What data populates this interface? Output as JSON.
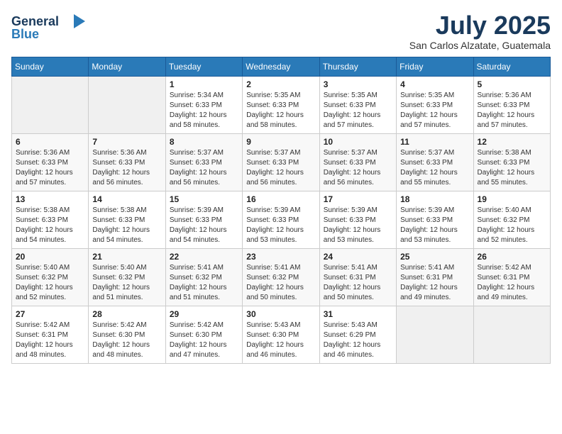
{
  "logo": {
    "general": "General",
    "blue": "Blue"
  },
  "title": {
    "month_year": "July 2025",
    "location": "San Carlos Alzatate, Guatemala"
  },
  "weekdays": [
    "Sunday",
    "Monday",
    "Tuesday",
    "Wednesday",
    "Thursday",
    "Friday",
    "Saturday"
  ],
  "weeks": [
    [
      {
        "day": "",
        "info": ""
      },
      {
        "day": "",
        "info": ""
      },
      {
        "day": "1",
        "info": "Sunrise: 5:34 AM\nSunset: 6:33 PM\nDaylight: 12 hours and 58 minutes."
      },
      {
        "day": "2",
        "info": "Sunrise: 5:35 AM\nSunset: 6:33 PM\nDaylight: 12 hours and 58 minutes."
      },
      {
        "day": "3",
        "info": "Sunrise: 5:35 AM\nSunset: 6:33 PM\nDaylight: 12 hours and 57 minutes."
      },
      {
        "day": "4",
        "info": "Sunrise: 5:35 AM\nSunset: 6:33 PM\nDaylight: 12 hours and 57 minutes."
      },
      {
        "day": "5",
        "info": "Sunrise: 5:36 AM\nSunset: 6:33 PM\nDaylight: 12 hours and 57 minutes."
      }
    ],
    [
      {
        "day": "6",
        "info": "Sunrise: 5:36 AM\nSunset: 6:33 PM\nDaylight: 12 hours and 57 minutes."
      },
      {
        "day": "7",
        "info": "Sunrise: 5:36 AM\nSunset: 6:33 PM\nDaylight: 12 hours and 56 minutes."
      },
      {
        "day": "8",
        "info": "Sunrise: 5:37 AM\nSunset: 6:33 PM\nDaylight: 12 hours and 56 minutes."
      },
      {
        "day": "9",
        "info": "Sunrise: 5:37 AM\nSunset: 6:33 PM\nDaylight: 12 hours and 56 minutes."
      },
      {
        "day": "10",
        "info": "Sunrise: 5:37 AM\nSunset: 6:33 PM\nDaylight: 12 hours and 56 minutes."
      },
      {
        "day": "11",
        "info": "Sunrise: 5:37 AM\nSunset: 6:33 PM\nDaylight: 12 hours and 55 minutes."
      },
      {
        "day": "12",
        "info": "Sunrise: 5:38 AM\nSunset: 6:33 PM\nDaylight: 12 hours and 55 minutes."
      }
    ],
    [
      {
        "day": "13",
        "info": "Sunrise: 5:38 AM\nSunset: 6:33 PM\nDaylight: 12 hours and 54 minutes."
      },
      {
        "day": "14",
        "info": "Sunrise: 5:38 AM\nSunset: 6:33 PM\nDaylight: 12 hours and 54 minutes."
      },
      {
        "day": "15",
        "info": "Sunrise: 5:39 AM\nSunset: 6:33 PM\nDaylight: 12 hours and 54 minutes."
      },
      {
        "day": "16",
        "info": "Sunrise: 5:39 AM\nSunset: 6:33 PM\nDaylight: 12 hours and 53 minutes."
      },
      {
        "day": "17",
        "info": "Sunrise: 5:39 AM\nSunset: 6:33 PM\nDaylight: 12 hours and 53 minutes."
      },
      {
        "day": "18",
        "info": "Sunrise: 5:39 AM\nSunset: 6:33 PM\nDaylight: 12 hours and 53 minutes."
      },
      {
        "day": "19",
        "info": "Sunrise: 5:40 AM\nSunset: 6:32 PM\nDaylight: 12 hours and 52 minutes."
      }
    ],
    [
      {
        "day": "20",
        "info": "Sunrise: 5:40 AM\nSunset: 6:32 PM\nDaylight: 12 hours and 52 minutes."
      },
      {
        "day": "21",
        "info": "Sunrise: 5:40 AM\nSunset: 6:32 PM\nDaylight: 12 hours and 51 minutes."
      },
      {
        "day": "22",
        "info": "Sunrise: 5:41 AM\nSunset: 6:32 PM\nDaylight: 12 hours and 51 minutes."
      },
      {
        "day": "23",
        "info": "Sunrise: 5:41 AM\nSunset: 6:32 PM\nDaylight: 12 hours and 50 minutes."
      },
      {
        "day": "24",
        "info": "Sunrise: 5:41 AM\nSunset: 6:31 PM\nDaylight: 12 hours and 50 minutes."
      },
      {
        "day": "25",
        "info": "Sunrise: 5:41 AM\nSunset: 6:31 PM\nDaylight: 12 hours and 49 minutes."
      },
      {
        "day": "26",
        "info": "Sunrise: 5:42 AM\nSunset: 6:31 PM\nDaylight: 12 hours and 49 minutes."
      }
    ],
    [
      {
        "day": "27",
        "info": "Sunrise: 5:42 AM\nSunset: 6:31 PM\nDaylight: 12 hours and 48 minutes."
      },
      {
        "day": "28",
        "info": "Sunrise: 5:42 AM\nSunset: 6:30 PM\nDaylight: 12 hours and 48 minutes."
      },
      {
        "day": "29",
        "info": "Sunrise: 5:42 AM\nSunset: 6:30 PM\nDaylight: 12 hours and 47 minutes."
      },
      {
        "day": "30",
        "info": "Sunrise: 5:43 AM\nSunset: 6:30 PM\nDaylight: 12 hours and 46 minutes."
      },
      {
        "day": "31",
        "info": "Sunrise: 5:43 AM\nSunset: 6:29 PM\nDaylight: 12 hours and 46 minutes."
      },
      {
        "day": "",
        "info": ""
      },
      {
        "day": "",
        "info": ""
      }
    ]
  ]
}
